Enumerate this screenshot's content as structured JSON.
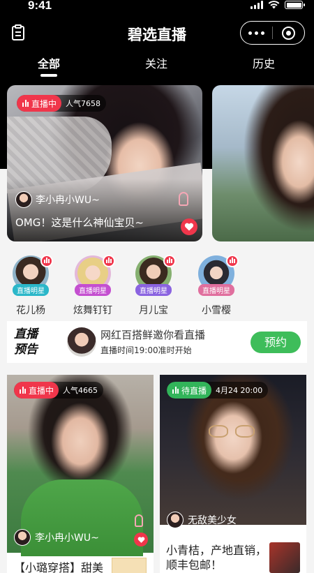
{
  "status_bar": {
    "time": "9:41"
  },
  "navbar": {
    "title": "碧选直播"
  },
  "tabs": [
    {
      "label": "全部",
      "active": true
    },
    {
      "label": "关注",
      "active": false
    },
    {
      "label": "历史",
      "active": false
    }
  ],
  "hero": {
    "status": "直播中",
    "popularity": "人气7658",
    "user": "李小冉小WU~",
    "title": "OMG！这是什么神仙宝贝~"
  },
  "stars": [
    {
      "name": "花儿杨",
      "tag": "直播明星",
      "tag_color": "#2bb7c9"
    },
    {
      "name": "炫舞钉钉",
      "tag": "直播明星",
      "tag_color": "#c44fd0"
    },
    {
      "name": "月儿宝",
      "tag": "直播明星",
      "tag_color": "#8a63e0"
    },
    {
      "name": "小雪樱",
      "tag": "直播明星",
      "tag_color": "#e06f9e"
    }
  ],
  "preview": {
    "logo_line1": "直播",
    "logo_line2": "预告",
    "title": "网红百搭鲜邀你看直播",
    "subtitle": "直播时间19:00准时开始",
    "reserve_label": "预约"
  },
  "cards": [
    {
      "status": "直播中",
      "meta": "人气4665",
      "user": "李小冉小WU~",
      "caption": "【小璐穿搭】甜美"
    },
    {
      "status": "待直播",
      "meta": "4月24 20:00",
      "user": "无敌美少女",
      "caption": "小青桔，产地直销，顺丰包邮！"
    }
  ],
  "colors": {
    "live_red": "#f0364b",
    "reserve_green": "#3ebd5a",
    "pending_green": "#32b45a"
  }
}
